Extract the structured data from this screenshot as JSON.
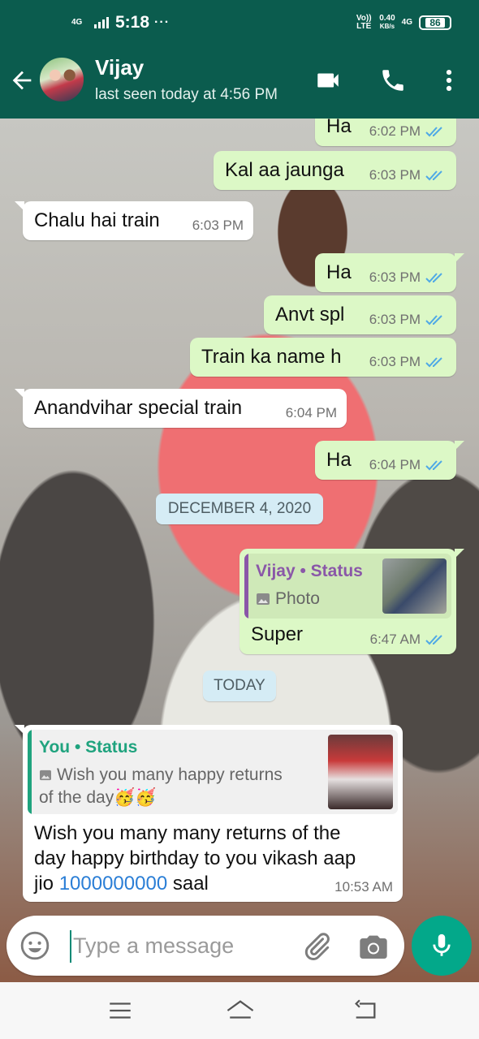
{
  "status_bar": {
    "network_left": "4G",
    "time": "5:18",
    "dots": "···",
    "volte": "Vo)) LTE",
    "speed_value": "0.40",
    "speed_unit": "KB/s",
    "network_right": "4G",
    "battery": "86"
  },
  "header": {
    "contact_name": "Vijay",
    "last_seen": "last seen today at 4:56 PM",
    "icons": [
      "back-arrow-icon",
      "video-call-icon",
      "voice-call-icon",
      "more-options-icon"
    ]
  },
  "messages": [
    {
      "dir": "out",
      "text": "Ha",
      "time": "6:02 PM",
      "ticks": "read"
    },
    {
      "dir": "out",
      "text": "Kal aa jaunga",
      "time": "6:03 PM",
      "ticks": "read"
    },
    {
      "dir": "in",
      "text": "Chalu hai train",
      "time": "6:03 PM"
    },
    {
      "dir": "out",
      "text": "Ha",
      "time": "6:03 PM",
      "ticks": "read"
    },
    {
      "dir": "out",
      "text": "Anvt spl",
      "time": "6:03 PM",
      "ticks": "read"
    },
    {
      "dir": "out",
      "text": "Train ka name h",
      "time": "6:03 PM",
      "ticks": "read"
    },
    {
      "dir": "in",
      "text": "Anandvihar special train",
      "time": "6:04 PM"
    },
    {
      "dir": "out",
      "text": "Ha",
      "time": "6:04 PM",
      "ticks": "read"
    }
  ],
  "date_dec": "DECEMBER 4, 2020",
  "reply_out": {
    "quote_title": "Vijay • Status",
    "quote_sub": "Photo",
    "text": "Super",
    "time": "6:47 AM",
    "ticks": "read"
  },
  "date_today": "TODAY",
  "reply_in": {
    "quote_title": "You • Status",
    "quote_line1": "Wish you many happy returns",
    "quote_line2": "of the day🥳🥳",
    "text_line1": "Wish you many many returns of the",
    "text_line2": "day happy birthday to you vikash aap",
    "text_line3_pre": "jio ",
    "text_line3_link": "1000000000",
    "text_line3_post": " saal",
    "time": "10:53 AM"
  },
  "input": {
    "placeholder": "Type a message",
    "value": ""
  },
  "colors": {
    "header": "#0b5c4e",
    "outgoing_bubble": "#dcf8c6",
    "incoming_bubble": "#ffffff",
    "read_ticks": "#4fa9e6",
    "date_chip": "#d5ecf5",
    "mic_button": "#03a88a",
    "link": "#2a7ed6"
  }
}
